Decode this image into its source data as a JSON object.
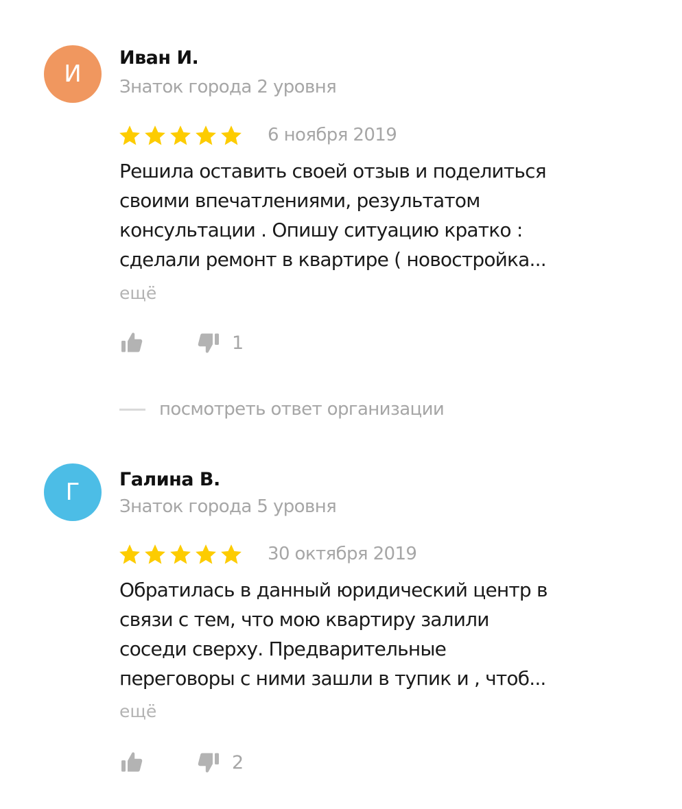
{
  "reviews": [
    {
      "avatar_letter": "И",
      "avatar_color": "#f0975f",
      "author": "Иван И.",
      "level": "Знаток города 2 уровня",
      "rating": 5,
      "date": "6 ноября 2019",
      "text_lines": [
        "Решила оставить своей отзыв и поделиться",
        "своими впечатлениями, результатом",
        "консультации . Опишу ситуацию кратко :",
        "сделали ремонт в квартире ( новостройка..."
      ],
      "more": "ещё",
      "likes": "",
      "dislikes": "1",
      "org_reply_label": "посмотреть ответ организации"
    },
    {
      "avatar_letter": "Г",
      "avatar_color": "#4cbde6",
      "author": "Галина В.",
      "level": "Знаток города 5 уровня",
      "rating": 5,
      "date": "30 октября 2019",
      "text_lines": [
        "Обратилась в данный юридический центр в",
        "связи с тем, что мою квартиру залили",
        "соседи сверху. Предварительные",
        "переговоры с ними зашли в тупик и , чтоб..."
      ],
      "more": "ещё",
      "likes": "",
      "dislikes": "2"
    }
  ],
  "colors": {
    "star": "#fdcc00",
    "muted": "#a6a6a6",
    "icon": "#b3b3b3"
  }
}
